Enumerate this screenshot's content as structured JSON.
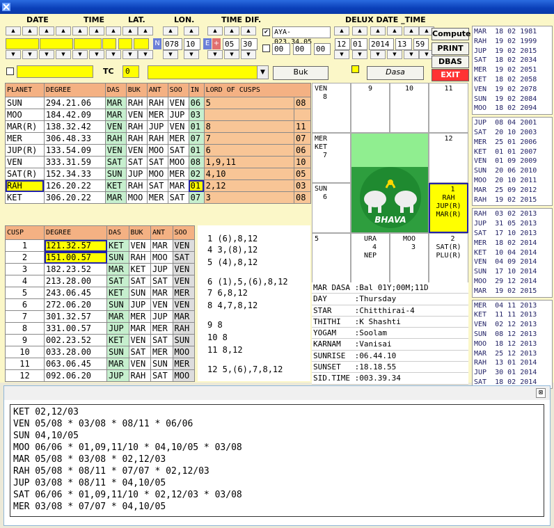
{
  "header": {
    "date": "DATE",
    "time": "TIME",
    "lat": "LAT.",
    "lon": "LON.",
    "timedif": "TIME DIF.",
    "delux": "DELUX DATE _TIME"
  },
  "inputs": {
    "lon_deg": "078",
    "lon_min": "10",
    "n_label": "N",
    "e_label": "E",
    "plus": "+",
    "tdif_h": "05",
    "tdif_m": "30",
    "aya": "AYA-023.34.05",
    "zero1": "00",
    "zero2": "00",
    "zero3": "00",
    "dd": "12",
    "dm": "01",
    "dy": "2014",
    "dh": "13",
    "dmin": "59",
    "tc_label": "TC",
    "tc_val": "0"
  },
  "buttons": {
    "compute": "Compute",
    "print": "PRINT",
    "dbas": "DBAS",
    "exit": "EXIT",
    "buk": "Buk",
    "dasa": "Dasa"
  },
  "planet_header": [
    "PLANET",
    "DEGREE",
    "DAS",
    "BUK",
    "ANT",
    "SOO",
    "IN",
    "LORD OF CUSPS"
  ],
  "planets": [
    [
      "SUN",
      "294.21.06",
      "MAR",
      "RAH",
      "RAH",
      "VEN",
      "06",
      "5"
    ],
    [
      "MOO",
      "184.42.09",
      "MAR",
      "VEN",
      "MER",
      "JUP",
      "03",
      ""
    ],
    [
      "MAR(R)",
      "138.32.42",
      "VEN",
      "RAH",
      "JUP",
      "VEN",
      "01",
      "8"
    ],
    [
      "MER",
      "306.48.33",
      "RAH",
      "RAH",
      "RAH",
      "MER",
      "07",
      "7"
    ],
    [
      "JUP(R)",
      "133.54.09",
      "VEN",
      "VEN",
      "MOO",
      "SAT",
      "01",
      "6"
    ],
    [
      "VEN",
      "333.31.59",
      "SAT",
      "SAT",
      "SAT",
      "MOO",
      "08",
      "1,9,11"
    ],
    [
      "SAT(R)",
      "152.34.33",
      "SUN",
      "JUP",
      "MOO",
      "MER",
      "02",
      "4,10"
    ],
    [
      "RAH",
      "126.20.22",
      "KET",
      "RAH",
      "SAT",
      "MAR",
      "01",
      "2,12"
    ],
    [
      "KET",
      "306.20.22",
      "MAR",
      "MOO",
      "MER",
      "SAT",
      "07",
      "3"
    ]
  ],
  "in_col": [
    "08",
    "",
    "11",
    "07",
    "06",
    "10",
    "05",
    "03",
    "08"
  ],
  "cusp_header": [
    "CUSP",
    "DEGREE",
    "DAS",
    "BUK",
    "ANT",
    "SOO"
  ],
  "cusps": [
    [
      "1",
      "121.32.57",
      "KET",
      "VEN",
      "MAR",
      "VEN"
    ],
    [
      "2",
      "151.00.57",
      "SUN",
      "RAH",
      "MOO",
      "SAT"
    ],
    [
      "3",
      "182.23.52",
      "MAR",
      "KET",
      "JUP",
      "VEN"
    ],
    [
      "4",
      "213.28.00",
      "SAT",
      "SAT",
      "SAT",
      "VEN"
    ],
    [
      "5",
      "243.06.45",
      "KET",
      "SUN",
      "MAR",
      "MER"
    ],
    [
      "6",
      "272.06.20",
      "SUN",
      "JUP",
      "VEN",
      "VEN"
    ],
    [
      "7",
      "301.32.57",
      "MAR",
      "MER",
      "JUP",
      "MAR"
    ],
    [
      "8",
      "331.00.57",
      "JUP",
      "MAR",
      "MER",
      "RAH"
    ],
    [
      "9",
      "002.23.52",
      "KET",
      "VEN",
      "SAT",
      "SUN"
    ],
    [
      "10",
      "033.28.00",
      "SUN",
      "SAT",
      "MER",
      "MOO"
    ],
    [
      "11",
      "063.06.45",
      "MAR",
      "VEN",
      "SUN",
      "MER"
    ],
    [
      "12",
      "092.06.20",
      "JUP",
      "RAH",
      "SAT",
      "MOO"
    ]
  ],
  "cusp_lords": [
    "1 (6),8,12",
    "4 3,(8),12",
    "5 (4),8,12",
    "6 (1),5,(6),8,12",
    "7 6,8,12",
    "8 4,7,8,12",
    "9 8",
    "10 8",
    "11 8,12",
    "12 5,(6),7,8,12"
  ],
  "chart": {
    "c1": "VEN\n  8",
    "c2": "9",
    "c3": "10",
    "c4": "11",
    "c5": "MER\nKET\n  7",
    "c6": "12",
    "c7": "SUN\n  6",
    "c8": "  1\nRAH\nJUP(R)\nMAR(R)",
    "c9": "5",
    "c10": "URA\n  4\nNEP",
    "c11": "MOO\n  3",
    "c12": "  2\nSAT(R)\nPLU(R)",
    "bhava": "BHAVA"
  },
  "info": [
    "MAR DASA :Bal 01Y;00M;11D",
    "DAY      :Thursday",
    "STAR     :Chitthirai-4",
    "THITHI   :K Shashti",
    "YOGAM    :Soolam",
    "KARNAM   :Vanisai",
    "SUNRISE  :06.44.10",
    "SUNSET   :18.18.55",
    "SID.TIME :003.39.34"
  ],
  "dasa_blocks": [
    [
      "MAR  18 02 1981",
      "RAH  19 02 1999",
      "JUP  19 02 2015",
      "SAT  18 02 2034",
      "MER  19 02 2051",
      "KET  18 02 2058",
      "VEN  19 02 2078",
      "SUN  19 02 2084",
      "MOO  18 02 2094"
    ],
    [
      "JUP  08 04 2001",
      "SAT  20 10 2003",
      "MER  25 01 2006",
      "KET  01 01 2007",
      "VEN  01 09 2009",
      "SUN  20 06 2010",
      "MOO  20 10 2011",
      "MAR  25 09 2012",
      "RAH  19 02 2015"
    ],
    [
      "RAH  03 02 2013",
      "JUP  31 05 2013",
      "SAT  17 10 2013",
      "MER  18 02 2014",
      "KET  10 04 2014",
      "VEN  04 09 2014",
      "SUN  17 10 2014",
      "MOO  29 12 2014",
      "MAR  19 02 2015"
    ],
    [
      "MER  04 11 2013",
      "KET  11 11 2013",
      "VEN  02 12 2013",
      "SUN  08 12 2013",
      "MOO  18 12 2013",
      "MAR  25 12 2013",
      "RAH  13 01 2014",
      "JUP  30 01 2014",
      "SAT  18 02 2014"
    ]
  ],
  "bottom_lines": [
    "KET 02,12/03",
    "VEN 05/08 * 03/08 * 08/11 * 06/06",
    "SUN 04,10/05",
    "MOO 06/06 * 01,09,11/10 * 04,10/05 * 03/08",
    "MAR 05/08 * 03/08 * 02,12/03",
    "RAH 05/08 * 08/11 * 07/07 * 02,12/03",
    "JUP 03/08 * 08/11 * 04,10/05",
    "SAT 06/06 * 01,09,11/10 * 02,12/03 * 03/08",
    "MER 03/08 * 07/07 * 04,10/05"
  ],
  "close_glyph": "⊠"
}
